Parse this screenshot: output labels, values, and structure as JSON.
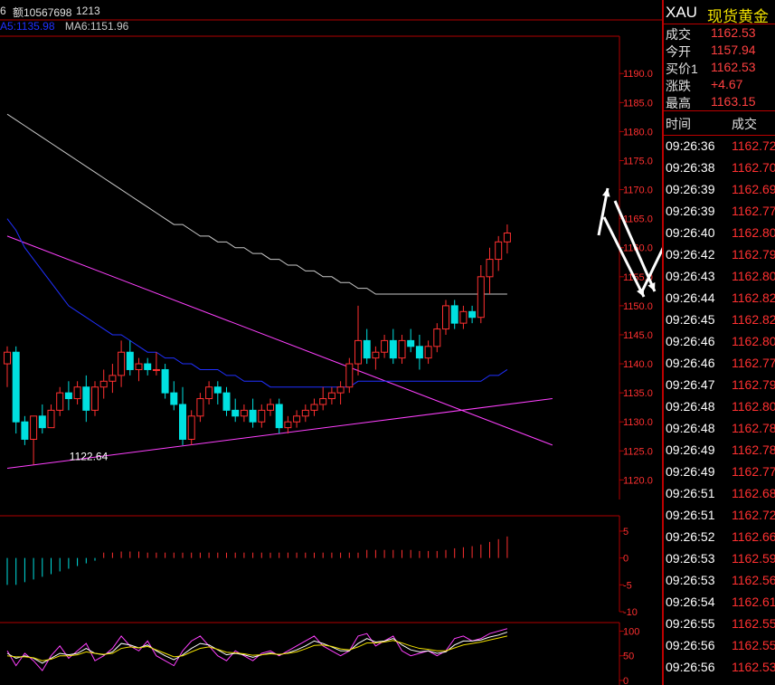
{
  "header": {
    "prefix": "6",
    "volume": "额10567698",
    "count": "1213",
    "ma5": "A5:1135.98",
    "ma6": "MA6:1151.96"
  },
  "colors": {
    "up": "#ff3030",
    "down": "#00e0e0",
    "ma5": "#2030ff",
    "ma6": "#c8c8c8",
    "border": "#b00000"
  },
  "right_panel": {
    "symbol": "XAU",
    "name": "现货黄金",
    "quotes": [
      {
        "label": "成交",
        "value": "1162.53"
      },
      {
        "label": "今开",
        "value": "1157.94"
      },
      {
        "label": "买价1",
        "value": "1162.53"
      },
      {
        "label": "涨跌",
        "value": "+4.67"
      },
      {
        "label": "最高",
        "value": "1163.15"
      }
    ],
    "tick_header_time": "时间",
    "tick_header_price": "成交",
    "ticks": [
      {
        "time": "09:26:36",
        "price": "1162.72"
      },
      {
        "time": "09:26:38",
        "price": "1162.70"
      },
      {
        "time": "09:26:39",
        "price": "1162.69"
      },
      {
        "time": "09:26:39",
        "price": "1162.77"
      },
      {
        "time": "09:26:40",
        "price": "1162.80"
      },
      {
        "time": "09:26:42",
        "price": "1162.79"
      },
      {
        "time": "09:26:43",
        "price": "1162.80"
      },
      {
        "time": "09:26:44",
        "price": "1162.82"
      },
      {
        "time": "09:26:45",
        "price": "1162.82"
      },
      {
        "time": "09:26:46",
        "price": "1162.80"
      },
      {
        "time": "09:26:46",
        "price": "1162.77"
      },
      {
        "time": "09:26:47",
        "price": "1162.79"
      },
      {
        "time": "09:26:48",
        "price": "1162.80"
      },
      {
        "time": "09:26:48",
        "price": "1162.78"
      },
      {
        "time": "09:26:49",
        "price": "1162.78"
      },
      {
        "time": "09:26:49",
        "price": "1162.77"
      },
      {
        "time": "09:26:51",
        "price": "1162.68"
      },
      {
        "time": "09:26:51",
        "price": "1162.72"
      },
      {
        "time": "09:26:52",
        "price": "1162.66"
      },
      {
        "time": "09:26:53",
        "price": "1162.59"
      },
      {
        "time": "09:26:53",
        "price": "1162.56"
      },
      {
        "time": "09:26:54",
        "price": "1162.61"
      },
      {
        "time": "09:26:55",
        "price": "1162.55"
      },
      {
        "time": "09:26:56",
        "price": "1162.55"
      },
      {
        "time": "09:26:56",
        "price": "1162.53"
      }
    ]
  },
  "chart_data": [
    {
      "type": "candlestick",
      "yticks": [
        "1190.0",
        "1185.0",
        "1180.0",
        "1175.0",
        "1170.0",
        "1165.0",
        "1160.0",
        "1155.0",
        "1150.0",
        "1145.0",
        "1140.0",
        "1135.0",
        "1130.0",
        "1125.0",
        "1120.0"
      ],
      "ylim": [
        1118.5,
        1193
      ],
      "annotations": [
        {
          "text": "1122.64",
          "x_index": 4,
          "value": 1122.64
        }
      ],
      "candles": [
        [
          1140,
          1143,
          1136,
          1142
        ],
        [
          1142,
          1143,
          1128,
          1130
        ],
        [
          1130,
          1131,
          1126,
          1127
        ],
        [
          1127,
          1129,
          1122.64,
          1131
        ],
        [
          1131,
          1133,
          1128,
          1129
        ],
        [
          1129,
          1133,
          1129,
          1132
        ],
        [
          1132,
          1136,
          1131,
          1135
        ],
        [
          1135,
          1137,
          1132,
          1134
        ],
        [
          1134,
          1137,
          1133,
          1136
        ],
        [
          1136,
          1138,
          1130,
          1132
        ],
        [
          1132,
          1137,
          1131,
          1136
        ],
        [
          1136,
          1139,
          1134,
          1137
        ],
        [
          1137,
          1140,
          1135,
          1138
        ],
        [
          1138,
          1144,
          1136,
          1142
        ],
        [
          1142,
          1144,
          1138,
          1139
        ],
        [
          1139,
          1141,
          1137,
          1140
        ],
        [
          1140,
          1141,
          1138,
          1139
        ],
        [
          1139,
          1142,
          1138,
          1139
        ],
        [
          1139,
          1140,
          1134,
          1135
        ],
        [
          1135,
          1137,
          1132,
          1133
        ],
        [
          1133,
          1136,
          1126,
          1127
        ],
        [
          1127,
          1132,
          1126,
          1131
        ],
        [
          1131,
          1135,
          1130,
          1134
        ],
        [
          1134,
          1137,
          1133,
          1136
        ],
        [
          1136,
          1137,
          1133,
          1135
        ],
        [
          1135,
          1136,
          1131,
          1132
        ],
        [
          1132,
          1134,
          1130,
          1131
        ],
        [
          1131,
          1133,
          1130,
          1132
        ],
        [
          1132,
          1134,
          1129,
          1130
        ],
        [
          1130,
          1133,
          1129,
          1132
        ],
        [
          1132,
          1134,
          1131,
          1133
        ],
        [
          1133,
          1134,
          1128,
          1129
        ],
        [
          1129,
          1131,
          1128,
          1130
        ],
        [
          1130,
          1132,
          1129,
          1131
        ],
        [
          1131,
          1133,
          1130,
          1132
        ],
        [
          1132,
          1134,
          1131,
          1133
        ],
        [
          1133,
          1136,
          1132,
          1134
        ],
        [
          1134,
          1136,
          1133,
          1135
        ],
        [
          1135,
          1137,
          1133,
          1136
        ],
        [
          1136,
          1141,
          1135,
          1140
        ],
        [
          1140,
          1150,
          1138,
          1144
        ],
        [
          1144,
          1146,
          1140,
          1141
        ],
        [
          1141,
          1143,
          1139,
          1142
        ],
        [
          1142,
          1145,
          1141,
          1144
        ],
        [
          1144,
          1146,
          1140,
          1141
        ],
        [
          1141,
          1145,
          1140,
          1144
        ],
        [
          1144,
          1146,
          1142,
          1143
        ],
        [
          1143,
          1145,
          1139,
          1141
        ],
        [
          1141,
          1144,
          1140,
          1143
        ],
        [
          1143,
          1147,
          1142,
          1146
        ],
        [
          1146,
          1151,
          1145,
          1150
        ],
        [
          1150,
          1151,
          1146,
          1147
        ],
        [
          1147,
          1150,
          1146,
          1149
        ],
        [
          1149,
          1150,
          1147,
          1148
        ],
        [
          1148,
          1157,
          1147,
          1155
        ],
        [
          1155,
          1160,
          1152,
          1158
        ],
        [
          1158,
          1162,
          1156,
          1161
        ],
        [
          1161,
          1164,
          1159,
          1162.53
        ]
      ],
      "series": [
        {
          "name": "MA5",
          "color": "#2030ff",
          "values": [
            1165,
            1163,
            1160,
            1158,
            1156,
            1154,
            1152,
            1150,
            1149,
            1148,
            1147,
            1146,
            1145,
            1145,
            1144,
            1143,
            1142,
            1142,
            1141,
            1141,
            1140,
            1140,
            1139,
            1139,
            1139,
            1138,
            1138,
            1137,
            1137,
            1137,
            1136,
            1136,
            1136,
            1136,
            1136,
            1136,
            1136,
            1136,
            1136,
            1136,
            1137,
            1137,
            1137,
            1137,
            1137,
            1137,
            1137,
            1137,
            1137,
            1137,
            1137,
            1137,
            1137,
            1137,
            1137,
            1138,
            1138,
            1139
          ]
        },
        {
          "name": "MA6",
          "color": "#c8c8c8",
          "values": [
            1183,
            1182,
            1181,
            1180,
            1179,
            1178,
            1177,
            1176,
            1175,
            1174,
            1173,
            1172,
            1171,
            1170,
            1169,
            1168,
            1167,
            1166,
            1165,
            1164,
            1164,
            1163,
            1162,
            1162,
            1161,
            1161,
            1160,
            1160,
            1159,
            1159,
            1158,
            1158,
            1157,
            1157,
            1156,
            1156,
            1155,
            1155,
            1154,
            1154,
            1153,
            1153,
            1152,
            1152,
            1152,
            1152,
            1152,
            1152,
            1152,
            1152,
            1152,
            1152,
            1152,
            1152,
            1152,
            1152,
            1152,
            1152
          ]
        }
      ],
      "trendlines": [
        {
          "from": [
            0,
            1122
          ],
          "to": [
            57,
            1134
          ]
        },
        {
          "from": [
            0,
            1162
          ],
          "to": [
            57,
            1126
          ]
        }
      ]
    },
    {
      "type": "bar",
      "yticks": [
        "5",
        "0",
        "-5",
        "-10"
      ],
      "ylim": [
        -10,
        6
      ],
      "values": [
        -5,
        -5,
        -4.5,
        -4,
        -3.5,
        -3,
        -2.5,
        -2,
        -1.5,
        -1,
        -0.5,
        1,
        1,
        1.2,
        1.2,
        1.2,
        1,
        1,
        1,
        1,
        1,
        1,
        1,
        1,
        1,
        1,
        1,
        1,
        1,
        1,
        1,
        1,
        1,
        1,
        1,
        1,
        1,
        1,
        1,
        1,
        1,
        1.5,
        1.5,
        1.5,
        1.5,
        1.5,
        1.5,
        1.3,
        1.3,
        1.3,
        1.5,
        1.8,
        2,
        2.2,
        2.5,
        3,
        3.5,
        4
      ]
    },
    {
      "type": "line",
      "yticks": [
        "100",
        "50",
        "0"
      ],
      "ylim": [
        0,
        110
      ],
      "series": [
        {
          "name": "K",
          "color": "#ff40ff",
          "values": [
            60,
            30,
            55,
            40,
            20,
            50,
            70,
            45,
            60,
            75,
            40,
            50,
            65,
            90,
            70,
            60,
            80,
            50,
            40,
            30,
            60,
            80,
            90,
            70,
            50,
            40,
            60,
            50,
            40,
            55,
            60,
            50,
            60,
            70,
            80,
            90,
            70,
            60,
            50,
            60,
            90,
            95,
            70,
            80,
            90,
            60,
            50,
            55,
            60,
            50,
            60,
            85,
            90,
            80,
            85,
            95,
            100,
            105
          ]
        },
        {
          "name": "D",
          "color": "#ffffff",
          "values": [
            55,
            45,
            50,
            45,
            35,
            45,
            55,
            52,
            55,
            65,
            55,
            52,
            58,
            75,
            72,
            66,
            72,
            60,
            50,
            42,
            52,
            65,
            75,
            72,
            62,
            52,
            55,
            52,
            47,
            52,
            56,
            52,
            56,
            62,
            70,
            80,
            75,
            68,
            60,
            60,
            75,
            85,
            78,
            80,
            85,
            72,
            62,
            58,
            60,
            55,
            58,
            72,
            80,
            80,
            82,
            88,
            92,
            98
          ]
        },
        {
          "name": "J",
          "color": "#f0e000",
          "values": [
            50,
            48,
            48,
            46,
            40,
            43,
            50,
            50,
            52,
            58,
            55,
            53,
            55,
            65,
            68,
            66,
            69,
            62,
            55,
            48,
            50,
            58,
            65,
            68,
            63,
            57,
            56,
            54,
            51,
            52,
            54,
            53,
            55,
            58,
            64,
            71,
            72,
            69,
            64,
            62,
            68,
            76,
            76,
            78,
            81,
            76,
            70,
            65,
            63,
            60,
            60,
            66,
            72,
            75,
            78,
            82,
            86,
            90
          ]
        }
      ]
    }
  ]
}
